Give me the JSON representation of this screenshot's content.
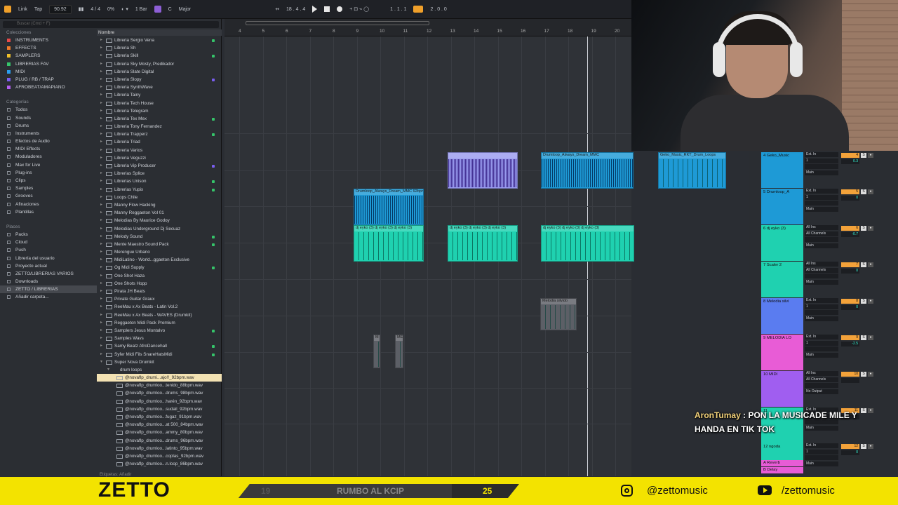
{
  "topbar": {
    "link": "Link",
    "tap": "Tap",
    "tempo": "90.92",
    "signature": "4 / 4",
    "percent": "0%",
    "bar": "1 Bar",
    "key": "C",
    "scale": "Major",
    "position": "18 .  4 .  4",
    "loop_start": "1 .  1 .  1",
    "loop_len": "2 .  0 .  0"
  },
  "browser": {
    "search_placeholder": "Buscar (Cmd + F)",
    "collections_title": "Colecciones",
    "collections": [
      {
        "label": "INSTRUMENTS",
        "color": "#e84a4a"
      },
      {
        "label": "EFFECTS",
        "color": "#f07a2a"
      },
      {
        "label": "SAMPLERS",
        "color": "#f0c02a"
      },
      {
        "label": "LIBRERIAS FAV",
        "color": "#35c46a"
      },
      {
        "label": "MIDI",
        "color": "#2a9ef0"
      },
      {
        "label": "PLUG / RB / TRAP",
        "color": "#7a5ef0"
      },
      {
        "label": "AFROBEAT/AMAPIANO",
        "color": "#b35ef0"
      }
    ],
    "categories_title": "Categorías",
    "categories": [
      "Todos",
      "Sounds",
      "Drums",
      "Instruments",
      "Efectos de Audio",
      "MIDI Effects",
      "Moduladores",
      "Max for Live",
      "Plug-ins",
      "Clips",
      "Samples",
      "Grooves",
      "Afinaciones",
      "Plantillas"
    ],
    "places_title": "Places",
    "places": [
      "Packs",
      "Cloud",
      "Push",
      "Librería del usuario",
      "Proyecto actual",
      "ZETTO/LIBRERIAS VARIOS",
      "Downloads",
      "ZETTO / LIBRERIAS",
      "Añadir carpeta..."
    ],
    "name_header": "Nombre",
    "items": [
      "Libreria Sergio Vena",
      "Libreria Sh",
      "Libreria Skill",
      "Libreria Sky Mosty, Predikador",
      "Libreria Slate Digital",
      "Libreria Slopy",
      "Libreria SynthWave",
      "Libreria Tainy",
      "Libreria Tech House",
      "Libreria Telegram",
      "Libreria Tex Mex",
      "Libreria Tony Fernandez",
      "Libreria Trapperz",
      "Libreria Triad",
      "Libreria Varios",
      "Libreria Veguzzi",
      "Libreria Vip Producer",
      "Librerias Splice",
      "Librerias Unison",
      "Librerias Yupix",
      "Loops Chile",
      "Manny Flow Hacking",
      "Manny Reggaeton Vol 01",
      "Melodias By Maurice Godoy",
      "Melodias Underground Dj Secuaz",
      "Melody Sound",
      "Mente Maestro Sound Pack",
      "Merengue Urbano",
      "MidiLatino - World...ggaeton Exclusive",
      "Og Midi Supply",
      "One Shot Haza",
      "One Shots Hopp",
      "Pirata JH Beats",
      "Private Guitar Graux",
      "ReeMau x Ax Beats - Latin Vol.2",
      "ReeMau x Ax Beats - WAVES (Drumkit)",
      "Reggaeton Midi Pack Premium",
      "Samplers Jesus Montalvo",
      "Samples Wavs",
      "Samy Beatz AfroDancehall",
      "Syfer Midi Fils SnareHatsMidi",
      "Super Nova Drumkit"
    ],
    "subfolder": "drum loops",
    "files": [
      "@novaflp_drumi...ajo!!_92bpm.wav",
      "@novaflp_drumloo...tenido_88bpm.wav",
      "@novaflp_drumloo...drums_98bpm.wav",
      "@novaflp_drumloo...harén_92bpm.wav",
      "@novaflp_drumloo...sudail_92bpm.wav",
      "@novaflp_drumloo...fugaz_91bpm.wav",
      "@novaflp_drumloo...at 500_84bpm.wav",
      "@novaflp_drumloo...ammy_80bpm.wav",
      "@novaflp_drumloo...drums_96bpm.wav",
      "@novaflp_drumloo...latinto_95bpm.wav",
      "@novaflp_drumloo...coplas_92bpm.wav",
      "@novaflp_drumloo...n.loop_86bpm.wav"
    ],
    "etiquetas": "Etiquetas:  Añadir"
  },
  "ruler": [
    "4",
    "5",
    "6",
    "7",
    "8",
    "9",
    "10",
    "11",
    "12",
    "13",
    "14",
    "15",
    "16",
    "17",
    "18",
    "19",
    "20"
  ],
  "clips": [
    {
      "label": "Drumloop_Always_Dream_MMC 92bpm",
      "color": "#1e9ad6"
    },
    {
      "label": "Drumloop_Always_Dream_MMC",
      "color": "#1e9ad6"
    },
    {
      "label": "Geko_Music_RKT_Drum_Loops",
      "color": "#1e9ad6"
    },
    {
      "label": "",
      "color": "#9a9cf0"
    },
    {
      "label": "dj eyko (3)  dj eyko (3)  dj eyko (3)",
      "color": "#1fd1b0"
    },
    {
      "label": "Melodia silvido",
      "color": "#5c5f66"
    },
    {
      "label": "M",
      "color": "#5c5f66"
    },
    {
      "label": "ME",
      "color": "#5c5f66"
    }
  ],
  "tracks": [
    {
      "name": "4 Geko_Music",
      "color": "#1e9ad6",
      "in": "Ext. In",
      "ch": "1",
      "out": "Main",
      "num": "4",
      "vol": "0.3"
    },
    {
      "name": "5 Drumloop_A",
      "color": "#1e9ad6",
      "in": "Ext. In",
      "ch": "1",
      "out": "Main",
      "num": "5",
      "vol": "0"
    },
    {
      "name": "6 dj eyko (3)",
      "color": "#1fd1b0",
      "in": "All Ins",
      "ch": "All Channels",
      "out": "Main",
      "num": "6",
      "vol": "-0.7"
    },
    {
      "name": "7 Scaler 2",
      "color": "#1fd1b0",
      "in": "All Ins",
      "ch": "All Channels",
      "out": "Main",
      "num": "7",
      "vol": "0"
    },
    {
      "name": "8 Melodia silvi",
      "color": "#5a7cf0",
      "in": "Ext. In",
      "ch": "1",
      "out": "Main",
      "num": "8",
      "vol": "0"
    },
    {
      "name": "9 MELODIA LO",
      "color": "#e85cd6",
      "in": "Ext. In",
      "ch": "1",
      "out": "Main",
      "num": "9",
      "vol": "-2.5"
    },
    {
      "name": "10 MIDI",
      "color": "#a05ef0",
      "in": "All Ins",
      "ch": "All Channels",
      "out": "No Output",
      "num": "10",
      "vol": ""
    },
    {
      "name": "11",
      "color": "#1fd1b0",
      "in": "Ext. In",
      "ch": "1",
      "out": "Main",
      "num": "11",
      "vol": ""
    },
    {
      "name": "12 ngoda",
      "color": "#1fd1b0",
      "in": "Ext. In",
      "ch": "1",
      "out": "Main",
      "num": "12",
      "vol": "0"
    }
  ],
  "returns": [
    {
      "name": "A Reverb",
      "color": "#e85cd6"
    },
    {
      "name": "B Delay",
      "color": "#e85cd6"
    }
  ],
  "chat": {
    "user": "AronTumay",
    "message": "PON LA MUSICADE MILE Y HANDA EN TIK TOK"
  },
  "footer": {
    "logo": "ZETTO",
    "progress_label": "RUMBO AL KCIP",
    "progress_from": "19",
    "progress_to": "25",
    "progress_fraction": 0.76,
    "instagram": "@zettomusic",
    "youtube": "/zettomusic"
  }
}
